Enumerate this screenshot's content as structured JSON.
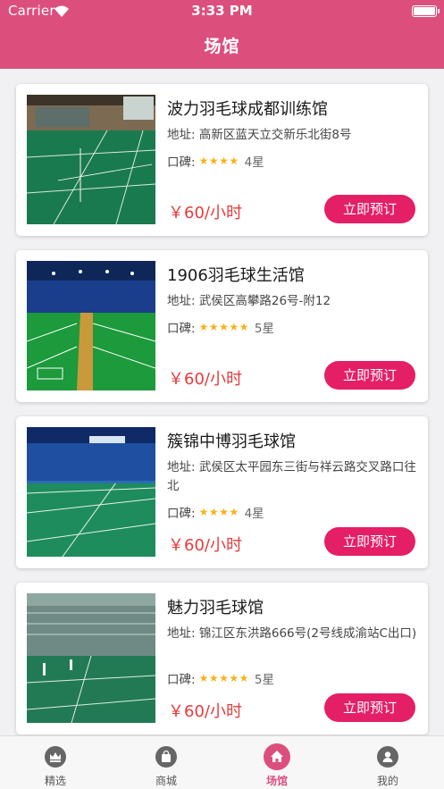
{
  "status_bar": {
    "carrier": "Carrier",
    "time": "3:33 PM"
  },
  "nav": {
    "title": "场馆"
  },
  "venues": [
    {
      "name": "波力羽毛球成都训练馆",
      "address_label": "地址:",
      "address": "高新区蓝天立交新乐北街8号",
      "rating_label": "口碑:",
      "stars": "★★★★",
      "rating_text": "4星",
      "price": "￥60/小时",
      "button": "立即预订"
    },
    {
      "name": "1906羽毛球生活馆",
      "address_label": "地址:",
      "address": "武侯区高攀路26号-附12",
      "rating_label": "口碑:",
      "stars": "★★★★★",
      "rating_text": "5星",
      "price": "￥60/小时",
      "button": "立即预订"
    },
    {
      "name": "簇锦中博羽毛球馆",
      "address_label": "地址:",
      "address": "武侯区太平园东三街与祥云路交叉路口往北",
      "rating_label": "口碑:",
      "stars": "★★★★",
      "rating_text": "4星",
      "price": "￥60/小时",
      "button": "立即预订"
    },
    {
      "name": "魅力羽毛球馆",
      "address_label": "地址:",
      "address": "锦江区东洪路666号(2号线成渝站C出口)",
      "rating_label": "口碑:",
      "stars": "★★★★★",
      "rating_text": "5星",
      "price": "￥60/小时",
      "button": "立即预订"
    }
  ],
  "tabs": [
    {
      "label": "精选",
      "icon": "crown-icon"
    },
    {
      "label": "商城",
      "icon": "shopping-bag-icon"
    },
    {
      "label": "场馆",
      "icon": "home-icon",
      "active": true
    },
    {
      "label": "我的",
      "icon": "user-icon"
    }
  ],
  "colors": {
    "brand": "#dc4f7d",
    "button": "#e41f66",
    "price": "#e63b3b",
    "star": "#f6b21c"
  }
}
